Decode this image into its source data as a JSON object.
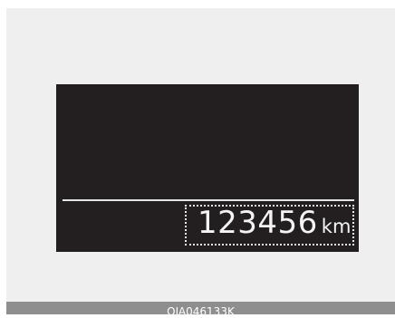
{
  "odometer": {
    "value": "123456",
    "unit": "km"
  },
  "caption": {
    "code": "OJA046133K"
  }
}
